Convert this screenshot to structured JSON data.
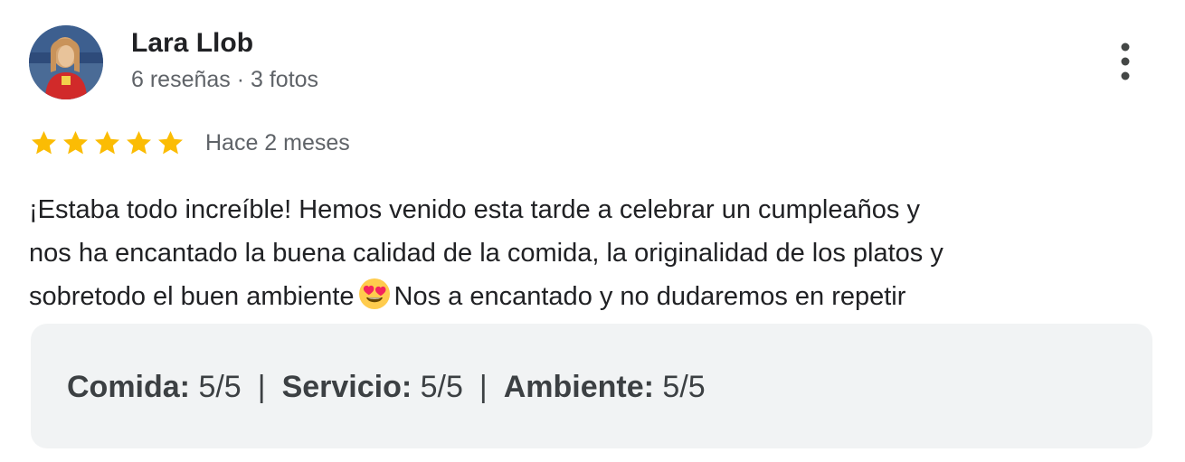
{
  "author": {
    "name": "Lara Llob",
    "meta": "6 reseñas · 3 fotos",
    "avatar_icon": "user-photo-avatar"
  },
  "menu": {
    "icon": "more-vertical-icon"
  },
  "rating": {
    "stars": 5,
    "max_stars": 5,
    "star_color": "#fbbc04",
    "date": "Hace 2 meses"
  },
  "review": {
    "line1": "¡Estaba todo increíble! Hemos venido esta tarde a celebrar un cumpleaños y",
    "line2": "nos ha encantado la buena calidad de la comida, la originalidad de los platos y",
    "line3_before": "sobretodo el buen ambiente",
    "emoji": "heart-eyes-emoji",
    "line3_after": "Nos a encantado y no dudaremos en repetir"
  },
  "sub_ratings": {
    "food_label": "Comida:",
    "food_value": " 5/5",
    "service_label": "Servicio:",
    "service_value": " 5/5",
    "ambience_label": "Ambiente:",
    "ambience_value": " 5/5",
    "separator": "|"
  },
  "colors": {
    "text_primary": "#202124",
    "text_secondary": "#5f6368",
    "box_background": "#f1f3f4"
  }
}
